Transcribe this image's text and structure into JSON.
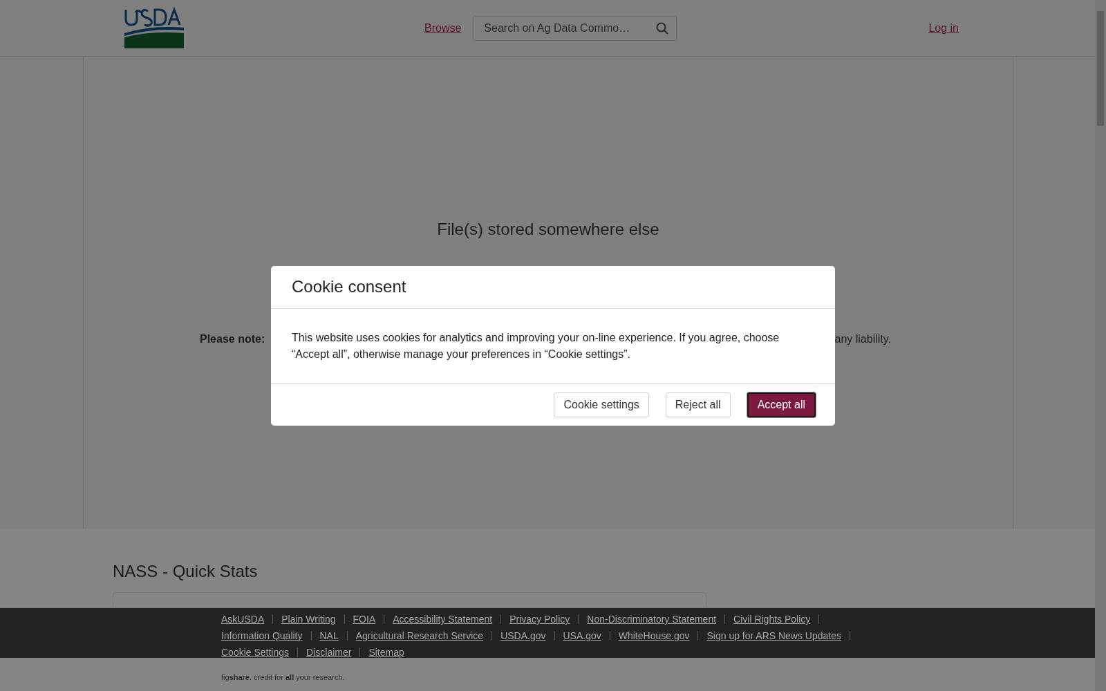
{
  "header": {
    "nav_link": "Browse",
    "search": {
      "placeholder": "Search on Ag Data Commo…"
    },
    "login_link": "Log in"
  },
  "main": {
    "title": "File(s) stored somewhere else",
    "note_left": "**Please note:**",
    "note_right": "any liability."
  },
  "section": {
    "title": "NASS - Quick Stats"
  },
  "modal": {
    "title": "Cookie consent",
    "body": "This website uses cookies for analytics and improving your on-line experience. If you agree, choose “Accept all”, otherwise manage your preferences in “Cookie settings”.",
    "buttons": [
      {
        "label": "Cookie settings",
        "kind": "secondary"
      },
      {
        "label": "Reject all",
        "kind": "secondary"
      },
      {
        "label": "Accept all",
        "kind": "primary"
      }
    ]
  },
  "footer": {
    "links": [
      "AskUSDA",
      "Plain Writing",
      "FOIA",
      "Accessibility Statement",
      "Privacy Policy",
      "Non-Discriminatory Statement",
      "Civil Rights Policy",
      "Information Quality",
      "NAL",
      "Agricultural Research Service",
      "USDA.gov",
      "USA.gov",
      "WhiteHouse.gov",
      "Sign up for ARS News Updates",
      "Cookie Settings",
      "Disclaimer",
      "Sitemap"
    ],
    "credit": "fig**share**. credit for **all** your research."
  }
}
